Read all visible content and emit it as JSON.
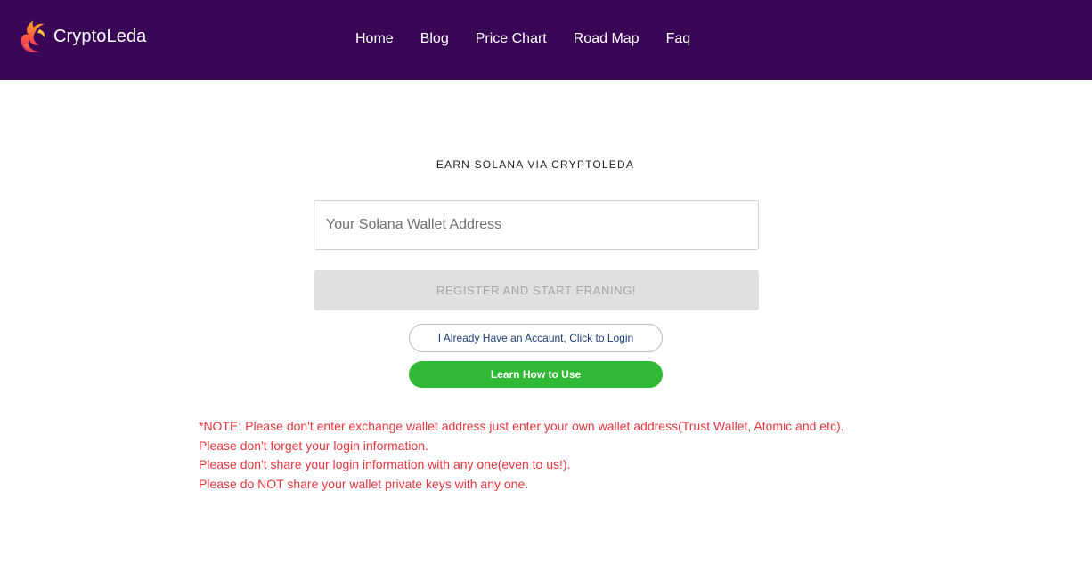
{
  "header": {
    "brand": "CryptoLeda",
    "logo_icon": "flame-swirl-logo",
    "background_color": "#3a0656",
    "nav": [
      {
        "label": "Home"
      },
      {
        "label": "Blog"
      },
      {
        "label": "Price Chart"
      },
      {
        "label": "Road Map"
      },
      {
        "label": "Faq"
      }
    ]
  },
  "main": {
    "headline": "EARN SOLANA VIA CRYPTOLEDA",
    "wallet_input": {
      "value": "",
      "placeholder": "Your Solana Wallet Address"
    },
    "register_button": "REGISTER AND START ERANING!",
    "login_button": "I Already Have an Accaunt, Click to Login",
    "learn_button": "Learn How to Use",
    "learn_button_color": "#2fb934",
    "notes": [
      "*NOTE: Please don't enter exchange wallet address just enter your own wallet address(Trust Wallet, Atomic and etc).",
      "Please don't forget your login information.",
      "Please don't share your login information with any one(even to us!).",
      "Please do NOT share your wallet private keys with any one."
    ],
    "notes_color": "#e5363f"
  }
}
